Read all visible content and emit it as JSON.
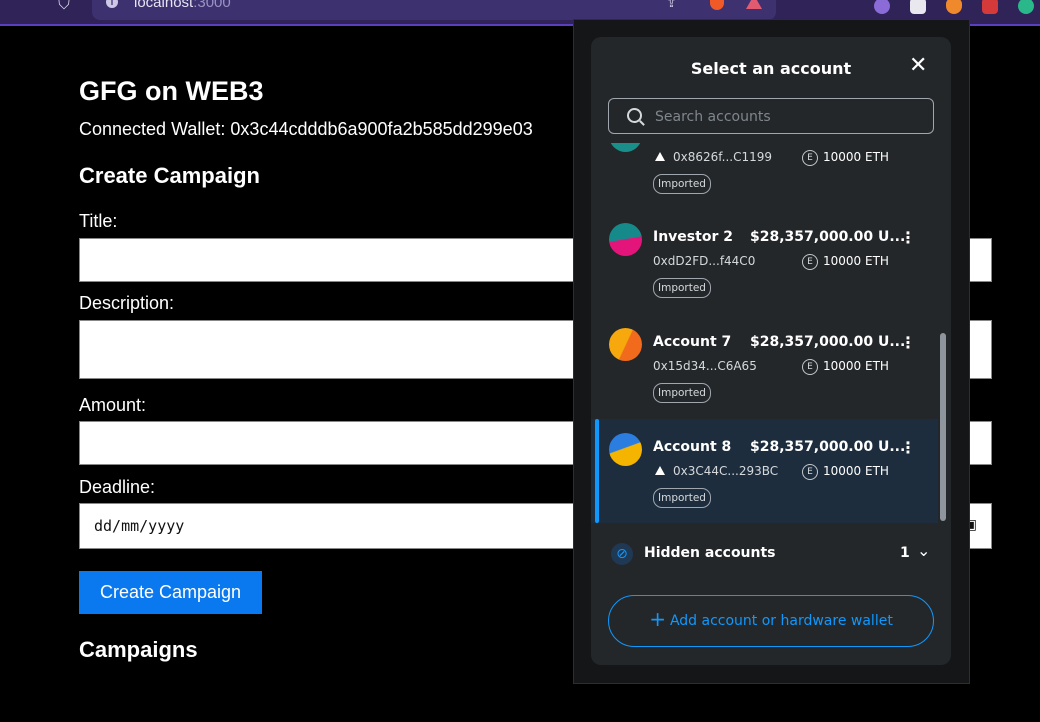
{
  "browser": {
    "url_host": "localhost",
    "url_port": ":3000"
  },
  "page": {
    "title": "GFG on WEB3",
    "wallet_prefix": "Connected Wallet: ",
    "wallet_address": "0x3c44cdddb6a900fa2b585dd299e03",
    "create_section": "Create Campaign",
    "labels": {
      "title": "Title:",
      "description": "Description:",
      "amount": "Amount:",
      "deadline": "Deadline:"
    },
    "deadline_placeholder": "dd/mm/yyyy",
    "create_button": "Create Campaign",
    "campaigns_section": "Campaigns"
  },
  "modal": {
    "title": "Select an account",
    "search_placeholder": "Search accounts",
    "accounts": [
      {
        "name": "",
        "usd": "",
        "address": "0x8626f...C1199",
        "eth": "10000 ETH",
        "tag": "Imported",
        "has_network_icon": true,
        "selected": false
      },
      {
        "name": "Investor 2",
        "usd": "$28,357,000.00 U...",
        "address": "0xdD2FD...f44C0",
        "eth": "10000 ETH",
        "tag": "Imported",
        "has_network_icon": false,
        "selected": false
      },
      {
        "name": "Account 7",
        "usd": "$28,357,000.00 U...",
        "address": "0x15d34...C6A65",
        "eth": "10000 ETH",
        "tag": "Imported",
        "has_network_icon": false,
        "selected": false
      },
      {
        "name": "Account 8",
        "usd": "$28,357,000.00 U...",
        "address": "0x3C44C...293BC",
        "eth": "10000 ETH",
        "tag": "Imported",
        "has_network_icon": true,
        "selected": true
      }
    ],
    "eth_badge": "E",
    "hidden_label": "Hidden accounts",
    "hidden_count": "1",
    "add_button": "Add account or hardware wallet"
  },
  "colors": {
    "accent": "#1098fc",
    "primary_button": "#0a79f0",
    "browser_bar": "#2f2358"
  }
}
